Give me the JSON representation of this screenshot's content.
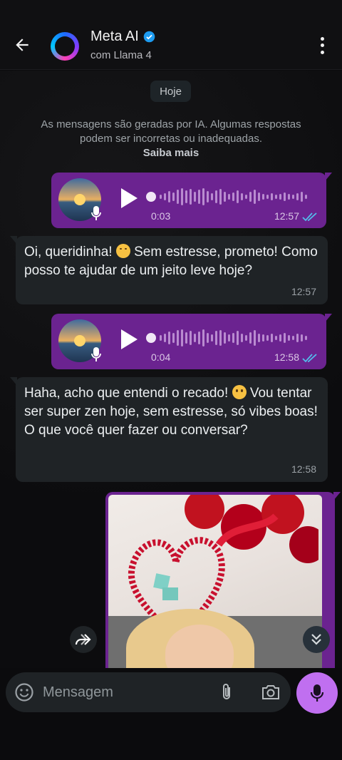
{
  "header": {
    "title": "Meta AI",
    "subtitle": "com Llama 4"
  },
  "chat": {
    "date_label": "Hoje",
    "notice": "As mensagens são geradas por IA. Algumas respostas podem ser incorretas ou inadequadas.",
    "notice_link": "Saiba mais",
    "messages": [
      {
        "type": "voice",
        "direction": "outgoing",
        "duration": "0:03",
        "time": "12:57"
      },
      {
        "type": "text",
        "direction": "incoming",
        "text_before_emoji": "Oi, queridinha! ",
        "emoji": "kissing-face",
        "text_after_emoji": " Sem estresse, prometo! Como posso te ajudar de um jeito leve hoje?",
        "time": "12:57"
      },
      {
        "type": "voice",
        "direction": "outgoing",
        "duration": "0:04",
        "time": "12:58"
      },
      {
        "type": "text",
        "direction": "incoming",
        "text_before_emoji": "Haha, acho que entendi o recado! ",
        "emoji": "grinning-face",
        "text_after_emoji": " Vou tentar ser super zen hoje, sem estresse, só vibes boas! O que você quer fazer ou conversar?",
        "time": "12:58"
      },
      {
        "type": "image",
        "direction": "outgoing"
      }
    ]
  },
  "composer": {
    "placeholder": "Mensagem"
  },
  "colors": {
    "outgoing_bubble": "#6b2390",
    "incoming_bubble": "#1f2326",
    "mic_button": "#c06ff0",
    "read_ticks": "#53bdeb"
  }
}
